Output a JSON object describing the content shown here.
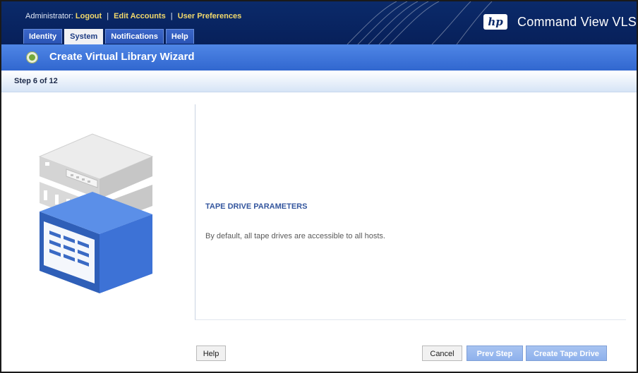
{
  "header": {
    "admin_label": "Administrator:",
    "links": [
      {
        "label": "Logout"
      },
      {
        "label": "Edit Accounts"
      },
      {
        "label": "User Preferences"
      }
    ],
    "separator": "|",
    "tabs": [
      {
        "label": "Identity"
      },
      {
        "label": "System",
        "active": true
      },
      {
        "label": "Notifications"
      },
      {
        "label": "Help"
      }
    ],
    "brand_logo_text": "hp",
    "product_name": "Command View VLS"
  },
  "wizard": {
    "title": "Create Virtual Library Wizard",
    "step": "Step 6 of 12"
  },
  "content": {
    "section_title": "TAPE DRIVE PARAMETERS",
    "description": "By default, all tape drives are accessible to all hosts."
  },
  "buttons": {
    "help": "Help",
    "cancel": "Cancel",
    "prev": "Prev Step",
    "create": "Create Tape Drive"
  },
  "colors": {
    "header_bg": "#0b2a6a",
    "wizard_bar": "#3b73d9",
    "link_yellow": "#f2d96b",
    "section_title": "#34569e",
    "primary_button": "#94b5ed"
  }
}
